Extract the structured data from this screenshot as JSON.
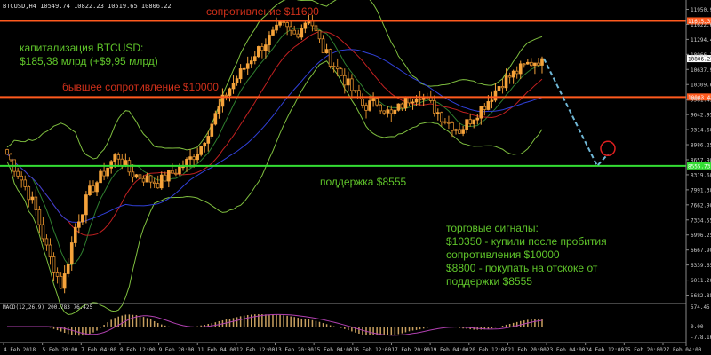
{
  "header": {
    "info": "BTCUSD,H4  10549.74 10822.23 10519.65 10806.22"
  },
  "colors": {
    "bg": "#000000",
    "grid": "#2a2a2a",
    "bull": "#f5a33b",
    "bear": "#d98a2a",
    "bb": "#7fbf3f",
    "ma_fast": "#2f7f2f",
    "ma_mid": "#c02020",
    "ma_slow": "#3040d8",
    "resistance": "#ff5a1e",
    "support": "#33dd33",
    "forecast": "#6fb7d6",
    "text_red": "#d0301a",
    "text_green": "#5fc42a",
    "macd": "#c8a060",
    "macd_signal": "#b040b0"
  },
  "annotations": {
    "resistance_label": "сопротивление $11600",
    "former_resistance_label": "бывшее сопротивление $10000",
    "support_label": "поддержка $8555",
    "cap_line1": "капитализация BTCUSD:",
    "cap_line2": "$185,38 млрд (+$9,95 млрд)",
    "signals_line1": "торговые сигналы:",
    "signals_line2": "$10350 - купили после пробития",
    "signals_line3": "сопротивления $10000",
    "signals_line4": "$8800 - покупать на отскоке от",
    "signals_line5": "поддержки $8555"
  },
  "macd": {
    "label": "MACD(12,26,9) 200.783 76.425",
    "ticks": [
      "574.45",
      "0.00",
      "-778.16"
    ]
  },
  "chart_data": {
    "type": "candlestick",
    "symbol": "BTCUSD",
    "timeframe": "H4",
    "ylim": [
      5682.85,
      12000
    ],
    "y_ticks": [
      "11950.90",
      "11622.65",
      "11294.40",
      "10966.20",
      "10637.95",
      "10309.60",
      "9981.45",
      "9642.95",
      "9314.60",
      "8986.25",
      "8657.90",
      "8319.60",
      "7991.30",
      "7662.90",
      "7334.55",
      "6996.25",
      "6667.90",
      "6339.65",
      "6011.20",
      "5682.85"
    ],
    "price_labels": {
      "resistance": "11615.35",
      "current": "10806.22",
      "former_resistance": "10003.42",
      "support": "8555.73"
    },
    "levels": {
      "resistance": 11600,
      "former_resistance": 10000,
      "support": 8555
    },
    "x_labels": [
      "4 Feb 2018",
      "5 Feb 20:00",
      "7 Feb 04:00",
      "8 Feb 12:00",
      "9 Feb 20:00",
      "11 Feb 04:00",
      "12 Feb 12:00",
      "13 Feb 20:00",
      "15 Feb 04:00",
      "16 Feb 12:00",
      "17 Feb 20:00",
      "19 Feb 04:00",
      "20 Feb 12:00",
      "21 Feb 20:00",
      "23 Feb 04:00",
      "24 Feb 12:00",
      "25 Feb 20:00",
      "27 Feb 04:00"
    ],
    "key_closes": [
      8800,
      8300,
      7700,
      6700,
      6000,
      7300,
      8000,
      8400,
      8800,
      8400,
      8300,
      8200,
      8400,
      8600,
      8900,
      9500,
      10100,
      10500,
      10900,
      11200,
      11500,
      11300,
      11700,
      11000,
      10600,
      10200,
      9800,
      9900,
      9600,
      9900,
      10100,
      9800,
      9500,
      9300,
      9600,
      9900,
      10300,
      10500,
      10700,
      10806
    ],
    "forecast": {
      "from": 10806,
      "to": 8555,
      "bounce": 8800
    }
  }
}
